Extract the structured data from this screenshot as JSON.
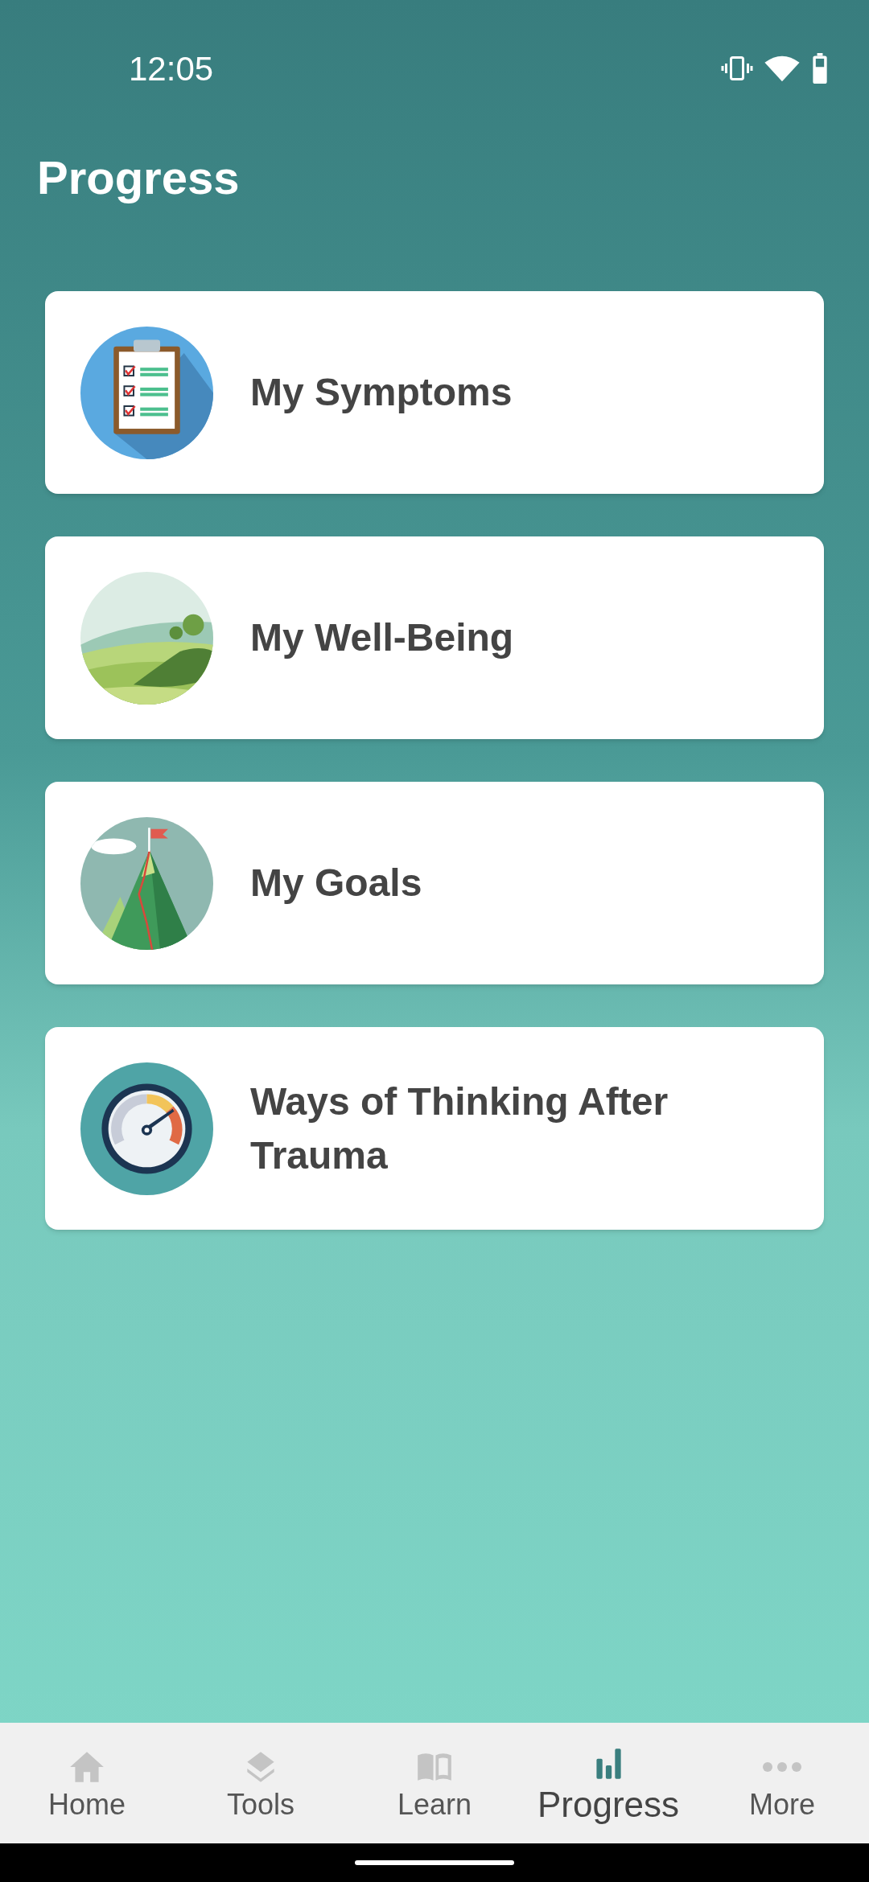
{
  "status_bar": {
    "time": "12:05"
  },
  "title": "Progress",
  "cards": [
    {
      "kind": "clipboard",
      "label": "My Symptoms"
    },
    {
      "kind": "landscape",
      "label": "My Well-Being"
    },
    {
      "kind": "mountain",
      "label": "My Goals"
    },
    {
      "kind": "gauge",
      "label": "Ways of Thinking After Trauma"
    }
  ],
  "nav": [
    {
      "kind": "home",
      "label": "Home",
      "selected": false
    },
    {
      "kind": "tools",
      "label": "Tools",
      "selected": false
    },
    {
      "kind": "learn",
      "label": "Learn",
      "selected": false
    },
    {
      "kind": "progress",
      "label": "Progress",
      "selected": true
    },
    {
      "kind": "more",
      "label": "More",
      "selected": false
    }
  ]
}
